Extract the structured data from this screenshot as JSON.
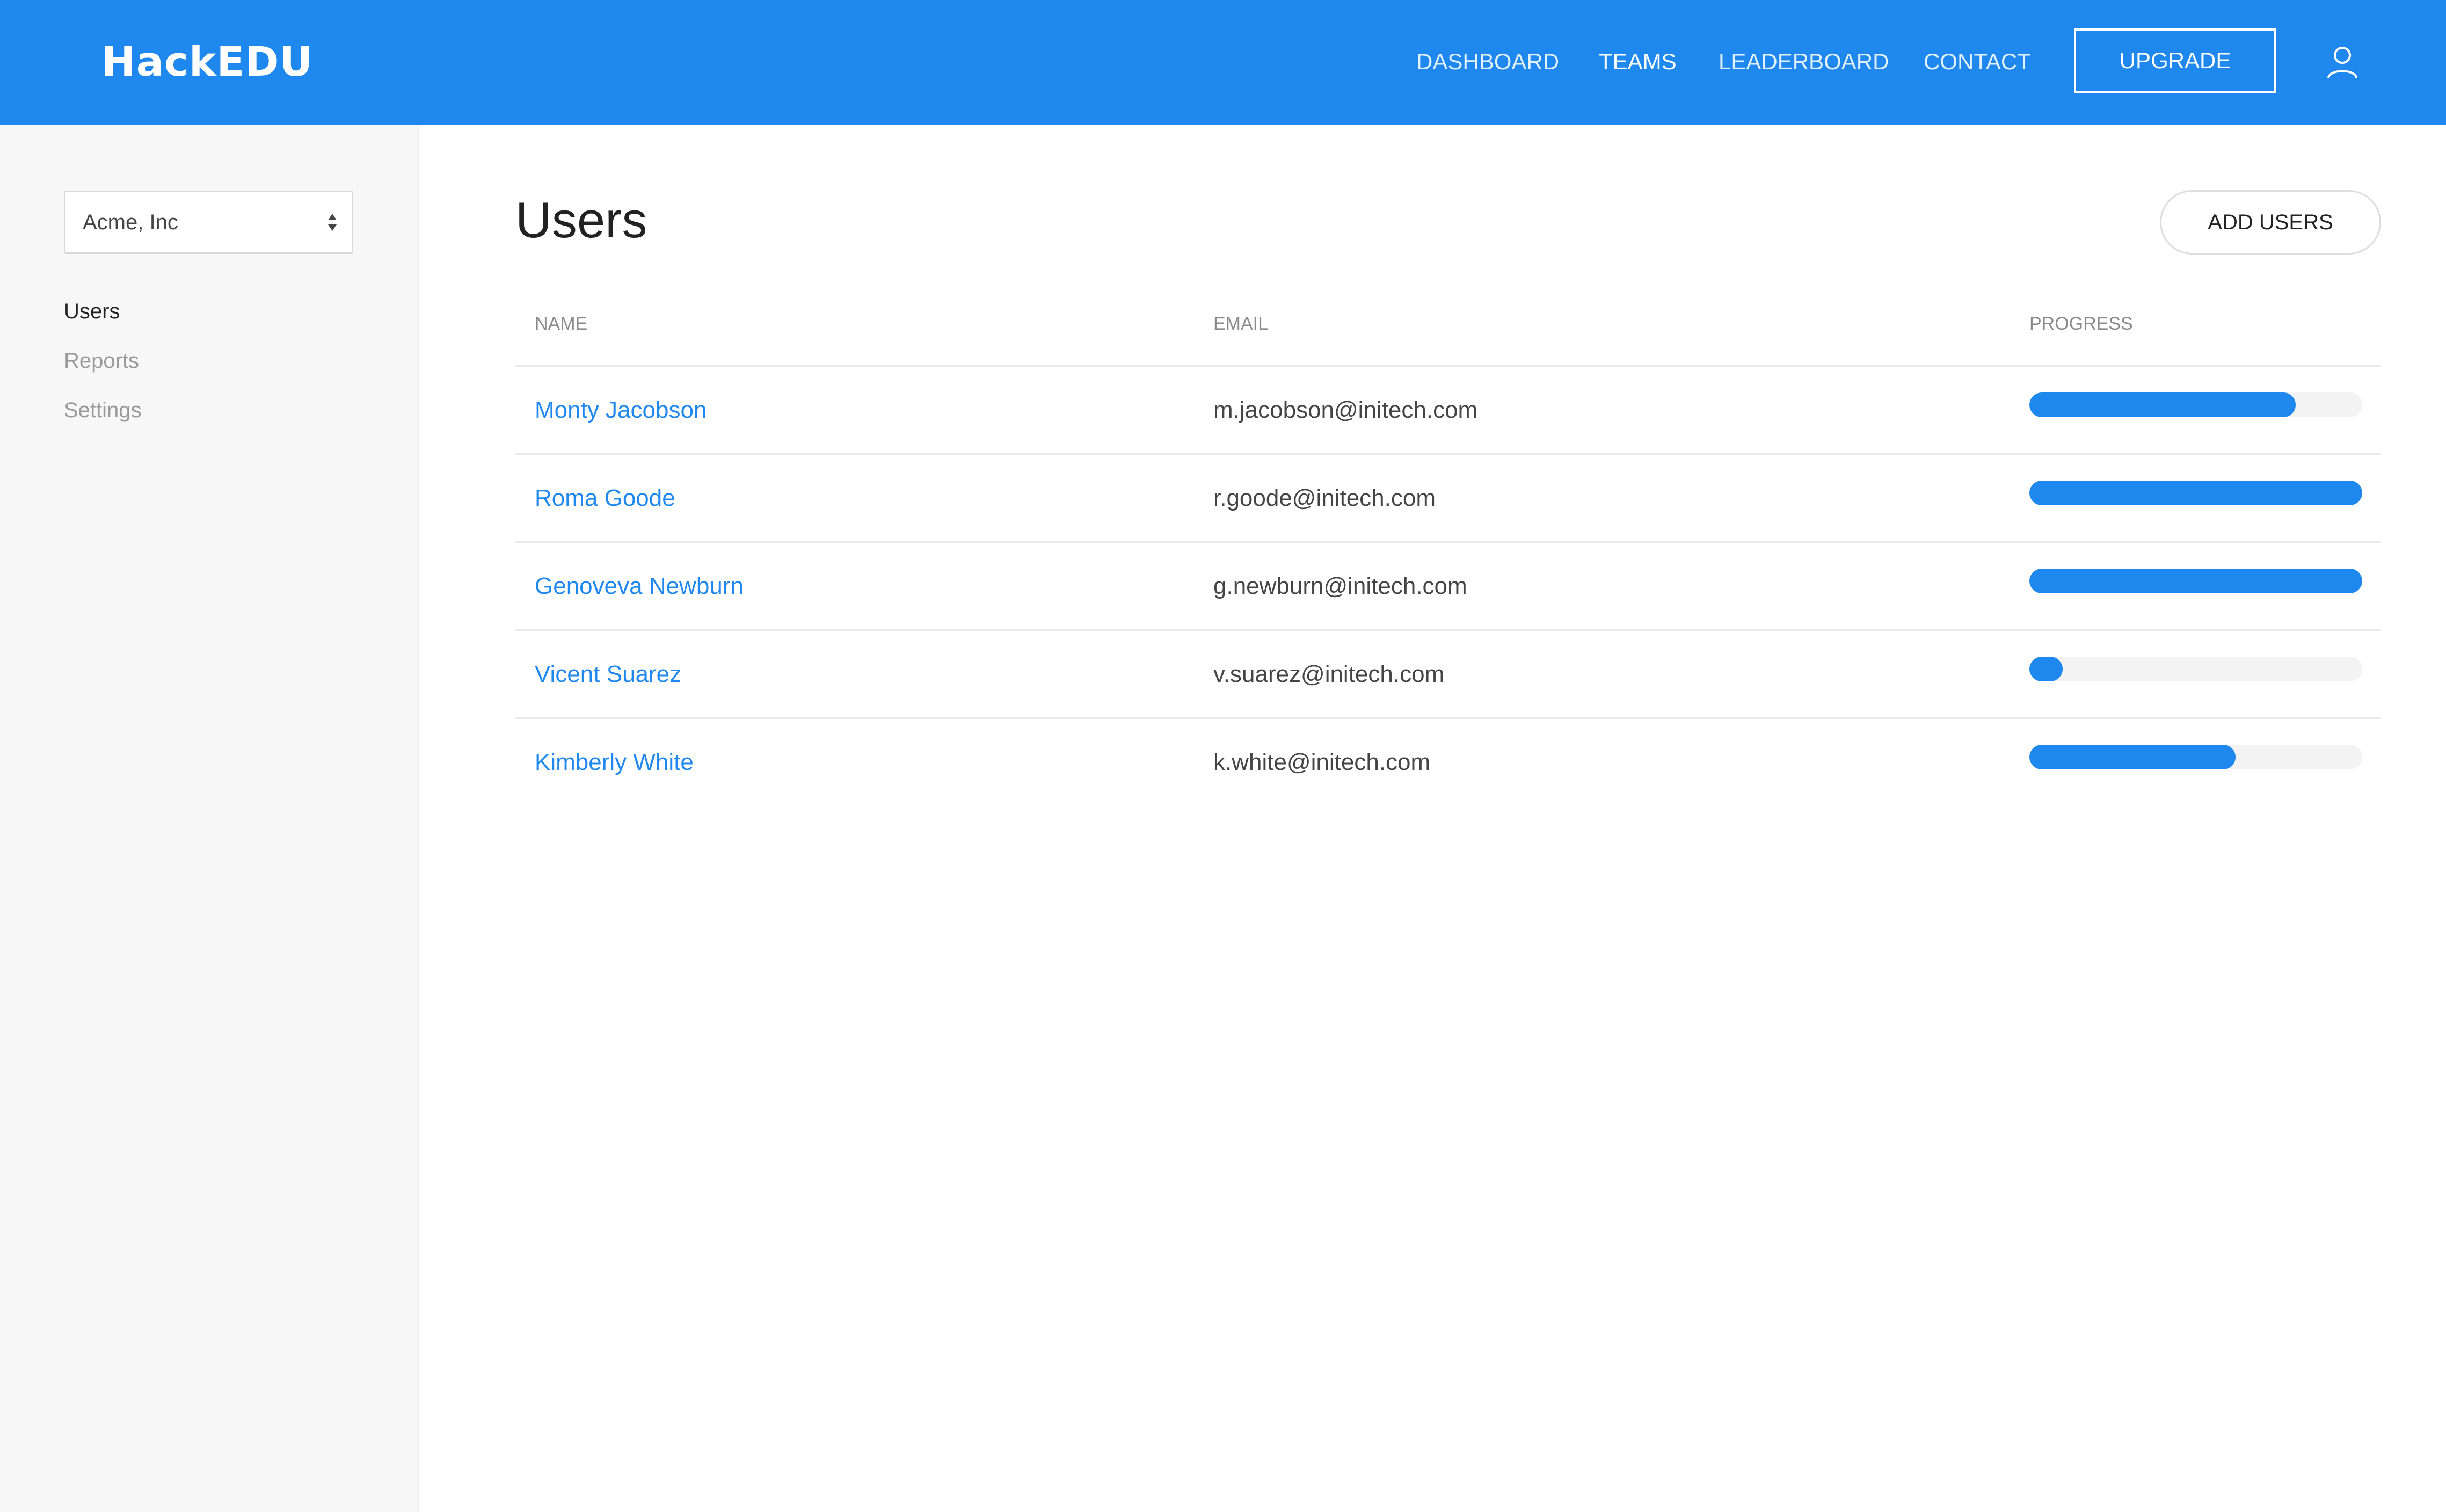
{
  "header": {
    "logo": "HackEDU",
    "nav": [
      {
        "label": "DASHBOARD",
        "active": false
      },
      {
        "label": "TEAMS",
        "active": true
      },
      {
        "label": "LEADERBOARD",
        "active": false
      },
      {
        "label": "CONTACT",
        "active": false
      }
    ],
    "upgrade_label": "UPGRADE",
    "user_icon": "user-icon"
  },
  "sidebar": {
    "org_select": {
      "value": "Acme, Inc",
      "icon": "select-arrows-icon"
    },
    "items": [
      {
        "label": "Users",
        "active": true
      },
      {
        "label": "Reports",
        "active": false
      },
      {
        "label": "Settings",
        "active": false
      }
    ]
  },
  "main": {
    "title": "Users",
    "add_users_label": "ADD USERS",
    "columns": {
      "name": "NAME",
      "email": "EMAIL",
      "progress": "PROGRESS"
    },
    "rows": [
      {
        "name": "Monty Jacobson",
        "email": "m.jacobson@initech.com",
        "progress": 0.8
      },
      {
        "name": "Roma Goode",
        "email": "r.goode@initech.com",
        "progress": 1.0
      },
      {
        "name": "Genoveva Newburn",
        "email": "g.newburn@initech.com",
        "progress": 1.0
      },
      {
        "name": "Vicent Suarez",
        "email": "v.suarez@initech.com",
        "progress": 0.1
      },
      {
        "name": "Kimberly White",
        "email": "k.white@initech.com",
        "progress": 0.62
      }
    ]
  },
  "colors": {
    "brand": "#1f88ee",
    "sidebar_bg": "#f7f7f7",
    "bar_track": "#f3f3f3"
  }
}
